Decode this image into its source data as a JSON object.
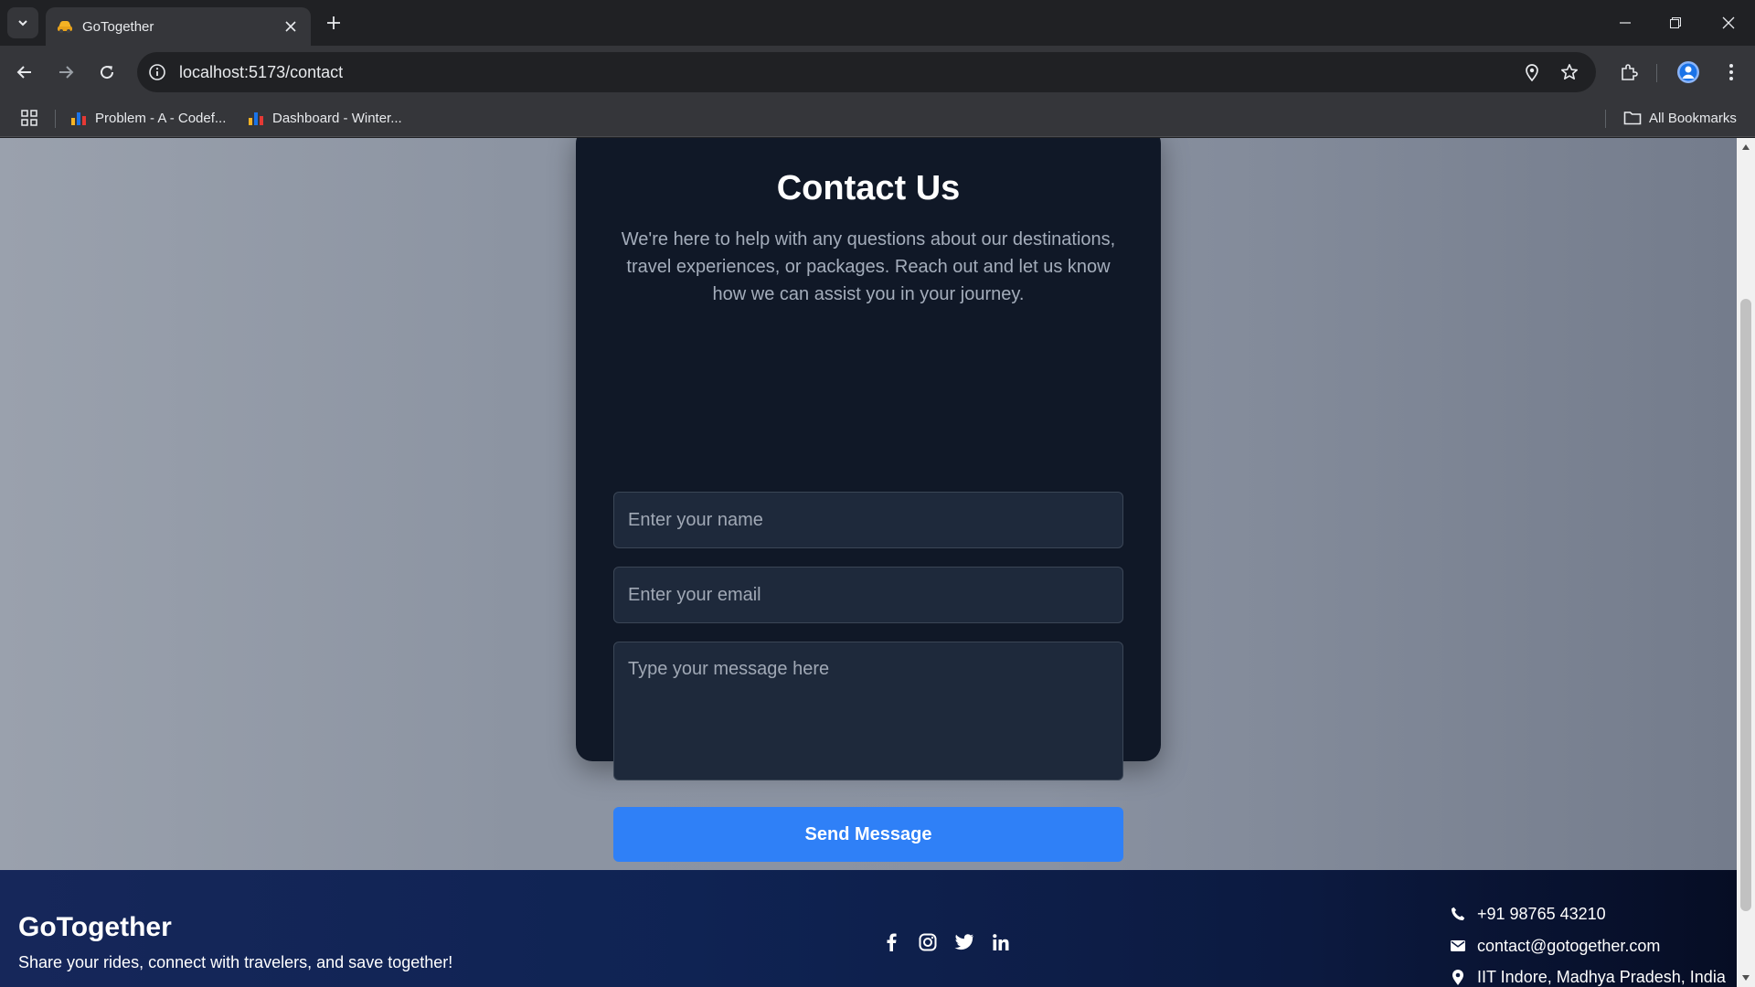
{
  "browser": {
    "tab_title": "GoTogether",
    "url": "localhost:5173/contact",
    "bookmarks": [
      {
        "label": "Problem - A - Codef..."
      },
      {
        "label": "Dashboard - Winter..."
      }
    ],
    "all_bookmarks_label": "All Bookmarks"
  },
  "contact": {
    "title": "Contact Us",
    "description": "We're here to help with any questions about our destinations, travel experiences, or packages. Reach out and let us know how we can assist you in your journey.",
    "name_placeholder": "Enter your name",
    "email_placeholder": "Enter your email",
    "message_placeholder": "Type your message here",
    "submit_label": "Send Message"
  },
  "footer": {
    "brand": "GoTogether",
    "tagline": "Share your rides, connect with travelers, and save together!",
    "social": [
      "facebook-icon",
      "instagram-icon",
      "twitter-icon",
      "linkedin-icon"
    ],
    "phone": "+91 98765 43210",
    "email": "contact@gotogether.com",
    "address": "IIT Indore, Madhya Pradesh, India"
  },
  "colors": {
    "card_bg": "#101827",
    "button": "#2f80f7",
    "footer": "#0f2353"
  }
}
